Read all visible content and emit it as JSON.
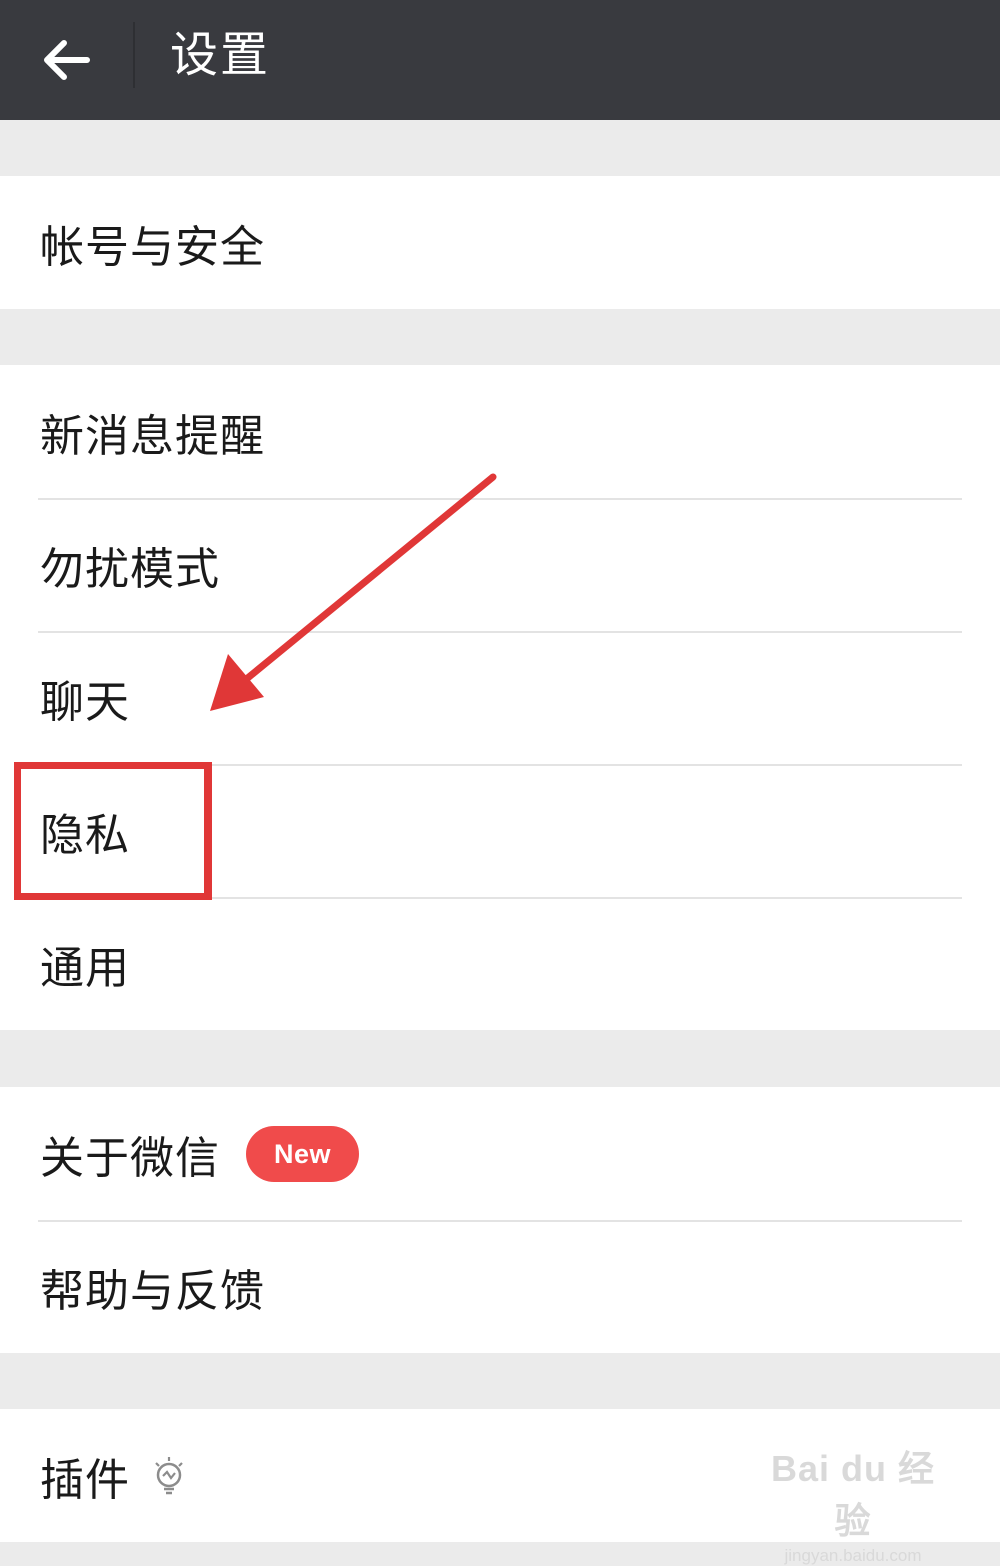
{
  "header": {
    "back_icon": "arrow-left-icon",
    "title": "设置"
  },
  "groups": [
    {
      "items": [
        {
          "label": "帐号与安全"
        }
      ]
    },
    {
      "items": [
        {
          "label": "新消息提醒"
        },
        {
          "label": "勿扰模式"
        },
        {
          "label": "聊天"
        },
        {
          "label": "隐私",
          "highlighted": true
        },
        {
          "label": "通用"
        }
      ]
    },
    {
      "items": [
        {
          "label": "关于微信",
          "badge": "New"
        },
        {
          "label": "帮助与反馈"
        }
      ]
    },
    {
      "items": [
        {
          "label": "插件",
          "icon": "lightbulb-icon"
        }
      ]
    }
  ],
  "annotation": {
    "color": "#e03737",
    "target": "隐私"
  },
  "watermark": {
    "main": "Bai du 经验",
    "sub": "jingyan.baidu.com"
  },
  "colors": {
    "header_bg": "#393a3f",
    "page_bg": "#ebebeb",
    "badge_bg": "#f04b4b"
  }
}
